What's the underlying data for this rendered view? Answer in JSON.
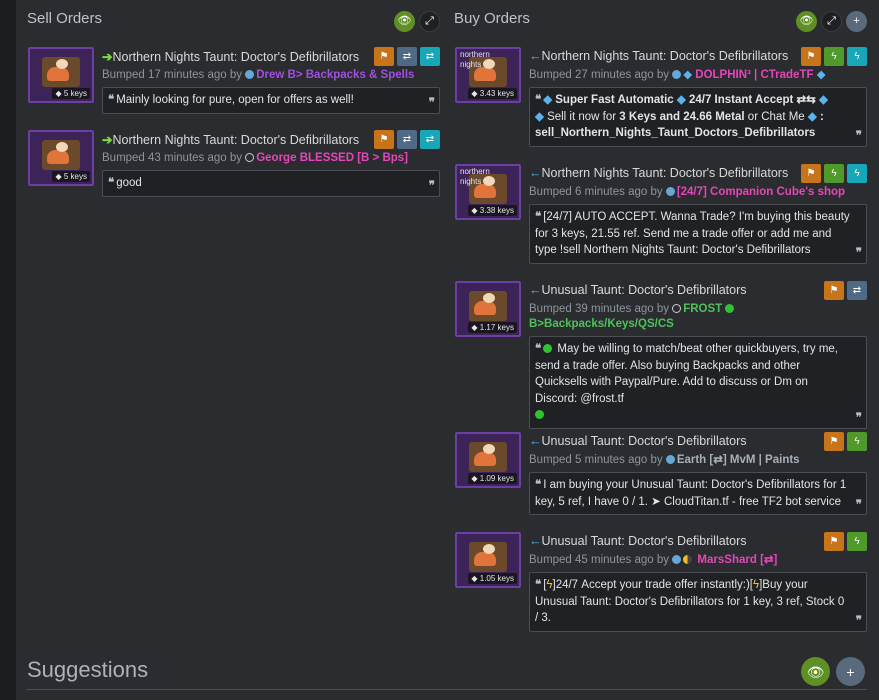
{
  "sell": {
    "title": "Sell Orders",
    "listings": [
      {
        "item": "Northern Nights Taunt: Doctor's Defibrillators",
        "price": "5 keys",
        "bumped": "Bumped 17 minutes ago by",
        "user": "Drew B> Backpacks & Spells",
        "message": "Mainly looking for pure, open for offers as well!"
      },
      {
        "item": "Northern Nights Taunt: Doctor's Defibrillators",
        "price": "5 keys",
        "bumped": "Bumped 43 minutes ago by",
        "user": "George",
        "user_suffix": "BLESSED [B > Bps]",
        "message": "good"
      }
    ]
  },
  "buy": {
    "title": "Buy Orders",
    "listings": [
      {
        "item": "Northern Nights Taunt: Doctor's Defibrillators",
        "thumb_tag": "northern nights",
        "price": "3.43 keys",
        "bumped": "Bumped 27 minutes ago by",
        "user": "DOLPHIN³ | CTradeTF",
        "message_a": "Super Fast Automatic",
        "message_b": "24/7 Instant Accept ⇄⇆",
        "message_c": "Sell it now for",
        "message_d": "3 Keys and 24.66 Metal",
        "message_e": "or Chat Me",
        "message_f": "sell_Northern_Nights_Taunt_Doctors_Defibrillators"
      },
      {
        "item": "Northern Nights Taunt: Doctor's Defibrillators",
        "thumb_tag": "northern nights",
        "price": "3.38 keys",
        "bumped": "Bumped 6 minutes ago by",
        "user": "[24/7] Companion Cube's shop",
        "message": "[24/7] AUTO ACCEPT. Wanna Trade? I'm buying this beauty for 3 keys, 21.55 ref. Send me a trade offer or add me and type !sell Northern Nights Taunt: Doctor's Defibrillators"
      },
      {
        "item": "Unusual Taunt: Doctor's Defibrillators",
        "price": "1.17 keys",
        "bumped": "Bumped 39 minutes ago by",
        "user": "FROST",
        "user_line2": "B>Backpacks/Keys/QS/CS",
        "message": "May be willing to match/beat other quickbuyers, try me, send a trade offer. Also buying Backpacks and other Quicksells with Paypal/Pure. Add to discuss or Dm on Discord: @frost.tf"
      },
      {
        "item": "Unusual Taunt: Doctor's Defibrillators",
        "price": "1.09 keys",
        "bumped": "Bumped 5 minutes ago by",
        "user": "Earth [⇄] MvM | Paints",
        "message": "I am buying your Unusual Taunt: Doctor's Defibrillators for 1 key, 5 ref, I have 0 / 1. ➤ CloudTitan.tf - free TF2 bot service"
      },
      {
        "item": "Unusual Taunt: Doctor's Defibrillators",
        "price": "1.05 keys",
        "bumped": "Bumped 45 minutes ago by",
        "user": "MarsShard",
        "user_suffix": "[⇄]",
        "message_pre": "[",
        "message_mid": "]24/7 Accept your trade offer instantly:)[",
        "message_post": "]Buy your Unusual Taunt: Doctor's Defibrillators for 1 key, 3 ref, Stock 0 / 3."
      }
    ]
  },
  "suggestions": {
    "title": "Suggestions"
  },
  "icons": {
    "eye": "👁",
    "expand": "⤢",
    "plus": "+",
    "flag": "⚑",
    "swap": "⇄",
    "bolt": "ϟ",
    "tag": "◆",
    "quote_open": "❝",
    "quote_close": "❞",
    "arrow_right": "➔",
    "arrow_left": "←"
  }
}
